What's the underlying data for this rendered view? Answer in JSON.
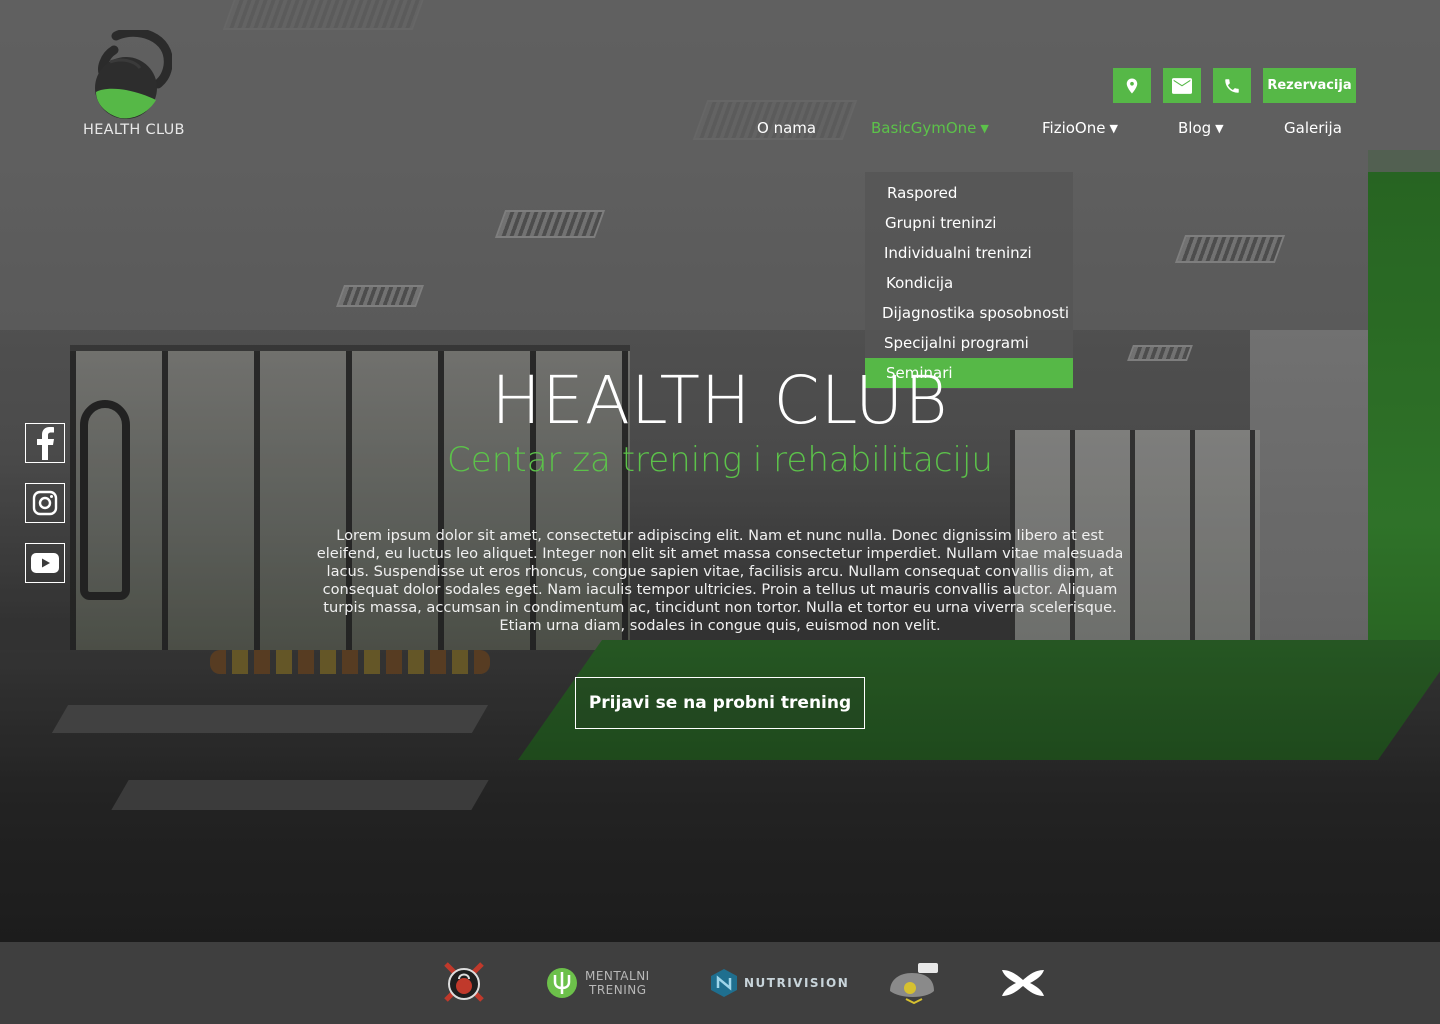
{
  "brand": {
    "logo_text": "HEALTH CLUB",
    "accent_color": "#56b847"
  },
  "top_actions": {
    "location_icon": "location-pin-icon",
    "mail_icon": "mail-icon",
    "phone_icon": "phone-icon",
    "reserve_label": "Rezervacija"
  },
  "nav": {
    "items": [
      {
        "label": "O nama",
        "has_dropdown": false,
        "active": false
      },
      {
        "label": "BasicGymOne",
        "has_dropdown": true,
        "active": true
      },
      {
        "label": "FizioOne",
        "has_dropdown": true,
        "active": false
      },
      {
        "label": "Blog",
        "has_dropdown": true,
        "active": false
      },
      {
        "label": "Galerija",
        "has_dropdown": false,
        "active": false
      }
    ],
    "caret": "▼"
  },
  "dropdown": {
    "items": [
      {
        "label": "Raspored"
      },
      {
        "label": "Grupni treninzi"
      },
      {
        "label": "Individualni treninzi"
      },
      {
        "label": "Kondicija"
      },
      {
        "label": "Dijagnostika sposobnosti"
      },
      {
        "label": "Specijalni programi"
      },
      {
        "label": "Seminari",
        "selected": true
      }
    ]
  },
  "social": {
    "facebook": "facebook-icon",
    "instagram": "instagram-icon",
    "youtube": "youtube-icon"
  },
  "hero": {
    "title": "HEALTH CLUB",
    "subtitle": "Centar za trening i rehabilitaciju",
    "text": "Lorem ipsum dolor sit amet, consectetur adipiscing elit. Nam et nunc nulla. Donec dignissim libero at est eleifend, eu luctus leo aliquet. Integer non elit sit amet massa consectetur imperdiet. Nullam vitae malesuada lacus. Suspendisse ut eros rhoncus, congue sapien vitae, facilisis arcu. Nullam consequat convallis diam, at consequat dolor sodales eget. Nam iaculis tempor ultricies. Proin a tellus ut mauris convallis auctor. Aliquam turpis massa, accumsan in condimentum ac, tincidunt non tortor. Nulla et tortor eu urna viverra scelerisque. Etiam urna diam, sodales in congue quis, euismod non velit.",
    "cta_label": "Prijavi se na probni trening"
  },
  "partners": {
    "mentalni_line1": "MENTALNI",
    "mentalni_line2": "TRENING",
    "nutrivision": "NUTRIVISION"
  }
}
